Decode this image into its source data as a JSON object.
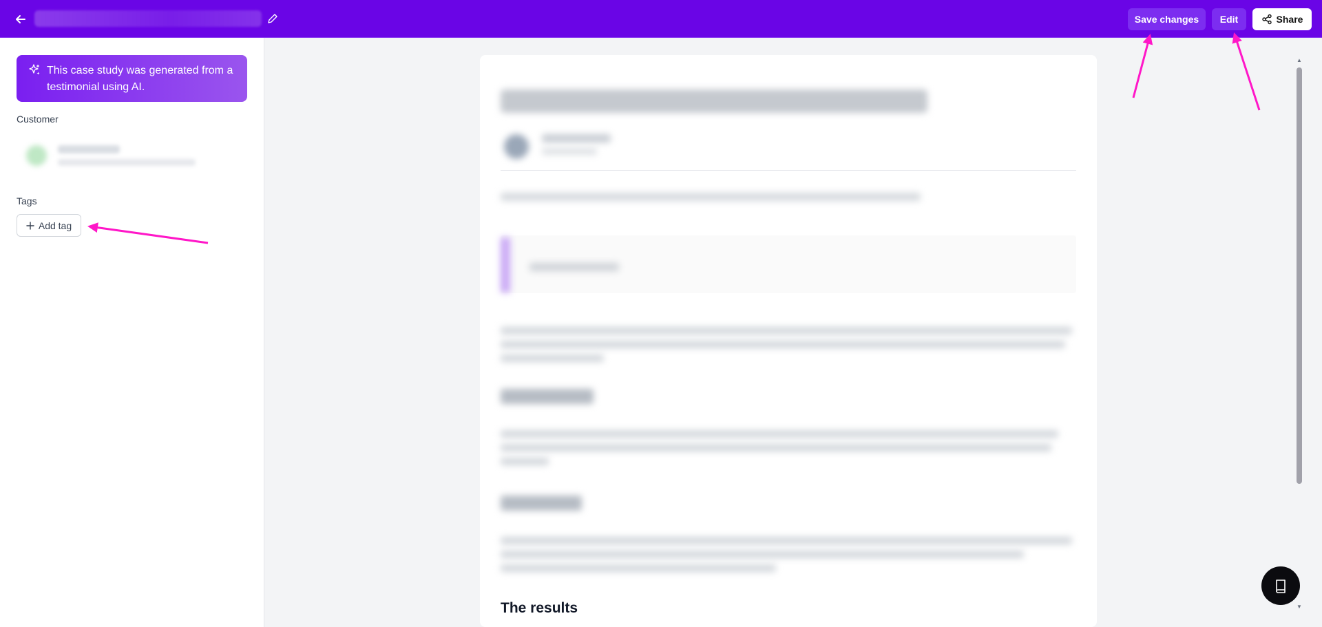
{
  "header": {
    "save_label": "Save changes",
    "edit_label": "Edit",
    "share_label": "Share"
  },
  "sidebar": {
    "ai_banner_text": "This case study was generated from a testimonial using AI.",
    "customer_label": "Customer",
    "tags_label": "Tags",
    "add_tag_label": "Add tag"
  },
  "document": {
    "results_heading": "The results"
  },
  "colors": {
    "topbar": "#6a05e6",
    "primary_button": "#7c2df0",
    "annotation_arrow": "#ff17c8"
  }
}
